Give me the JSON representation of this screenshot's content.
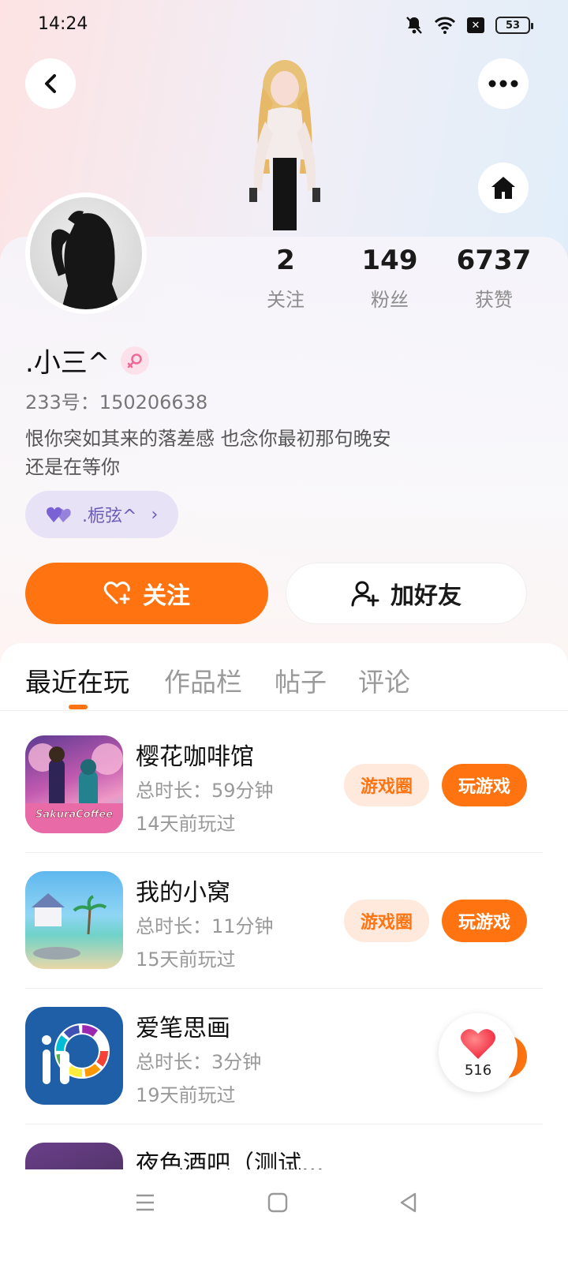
{
  "status_bar": {
    "time": "14:24",
    "battery": "53",
    "icons": [
      "mute-icon",
      "wifi-icon",
      "x-notification-icon",
      "battery-icon"
    ]
  },
  "header": {
    "back_icon": "back-arrow-icon",
    "more_icon": "more-dots-icon",
    "home_icon": "home-icon"
  },
  "profile": {
    "stats": [
      {
        "value": "2",
        "label": "关注"
      },
      {
        "value": "149",
        "label": "粉丝"
      },
      {
        "value": "6737",
        "label": "获赞"
      }
    ],
    "username": ".小三^",
    "gender": "female",
    "uid": "233号：150206638",
    "bio_lines": [
      "恨你突如其来的落差感 也念你最初那句晚安",
      "还是在等你"
    ],
    "cp_tag": ".栀弦^"
  },
  "actions": {
    "follow_label": "关注",
    "add_friend_label": "加好友"
  },
  "tabs": [
    {
      "label": "最近在玩",
      "active": true
    },
    {
      "label": "作品栏",
      "active": false
    },
    {
      "label": "帖子",
      "active": false
    },
    {
      "label": "评论",
      "active": false
    }
  ],
  "games": [
    {
      "title": "樱花咖啡馆",
      "duration": "总时长：59分钟",
      "last_played": "14天前玩过",
      "circle_label": "游戏圈",
      "play_label": "玩游戏",
      "icon_text": "SakuraCoffee"
    },
    {
      "title": "我的小窝",
      "duration": "总时长：11分钟",
      "last_played": "15天前玩过",
      "circle_label": "游戏圈",
      "play_label": "玩游戏"
    },
    {
      "title": "爱笔思画",
      "duration": "总时长：3分钟",
      "last_played": "19天前玩过",
      "icon_text": "iP"
    },
    {
      "title": "夜色酒吧（测试..."
    }
  ],
  "like_float": {
    "count": "516"
  },
  "colors": {
    "accent": "#ff7411",
    "accent_light": "#ffe8dc",
    "tag_bg": "#e8e2f7",
    "tag_text": "#6d5bb8"
  }
}
